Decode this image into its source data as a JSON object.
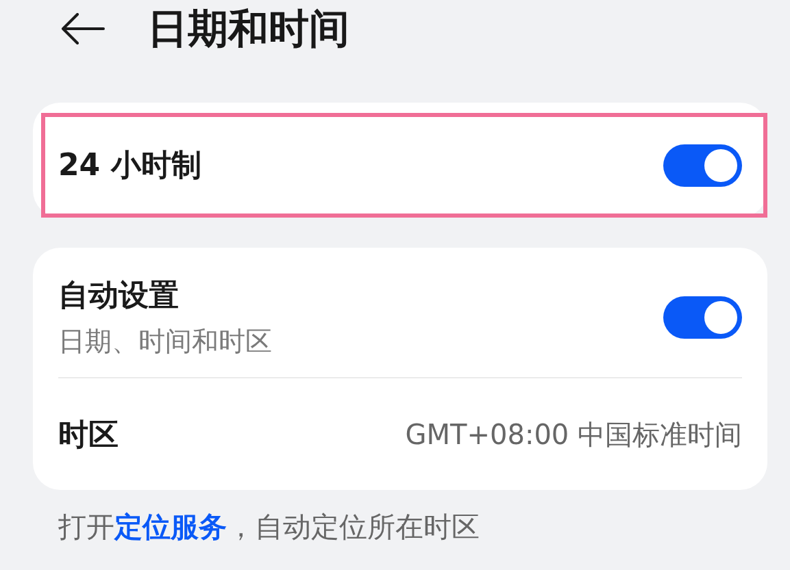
{
  "header": {
    "title": "日期和时间"
  },
  "cards": [
    {
      "highlighted": true,
      "rows": [
        {
          "kind": "toggle",
          "label": "24 小时制",
          "on": true
        }
      ]
    },
    {
      "highlighted": false,
      "rows": [
        {
          "kind": "toggle",
          "label": "自动设置",
          "subtitle": "日期、时间和时区",
          "on": true
        },
        {
          "kind": "value",
          "label": "时区",
          "value": "GMT+08:00 中国标准时间"
        }
      ]
    }
  ],
  "footer": {
    "text_before": "打开",
    "link": "定位服务",
    "text_after": "，自动定位所在时区"
  }
}
